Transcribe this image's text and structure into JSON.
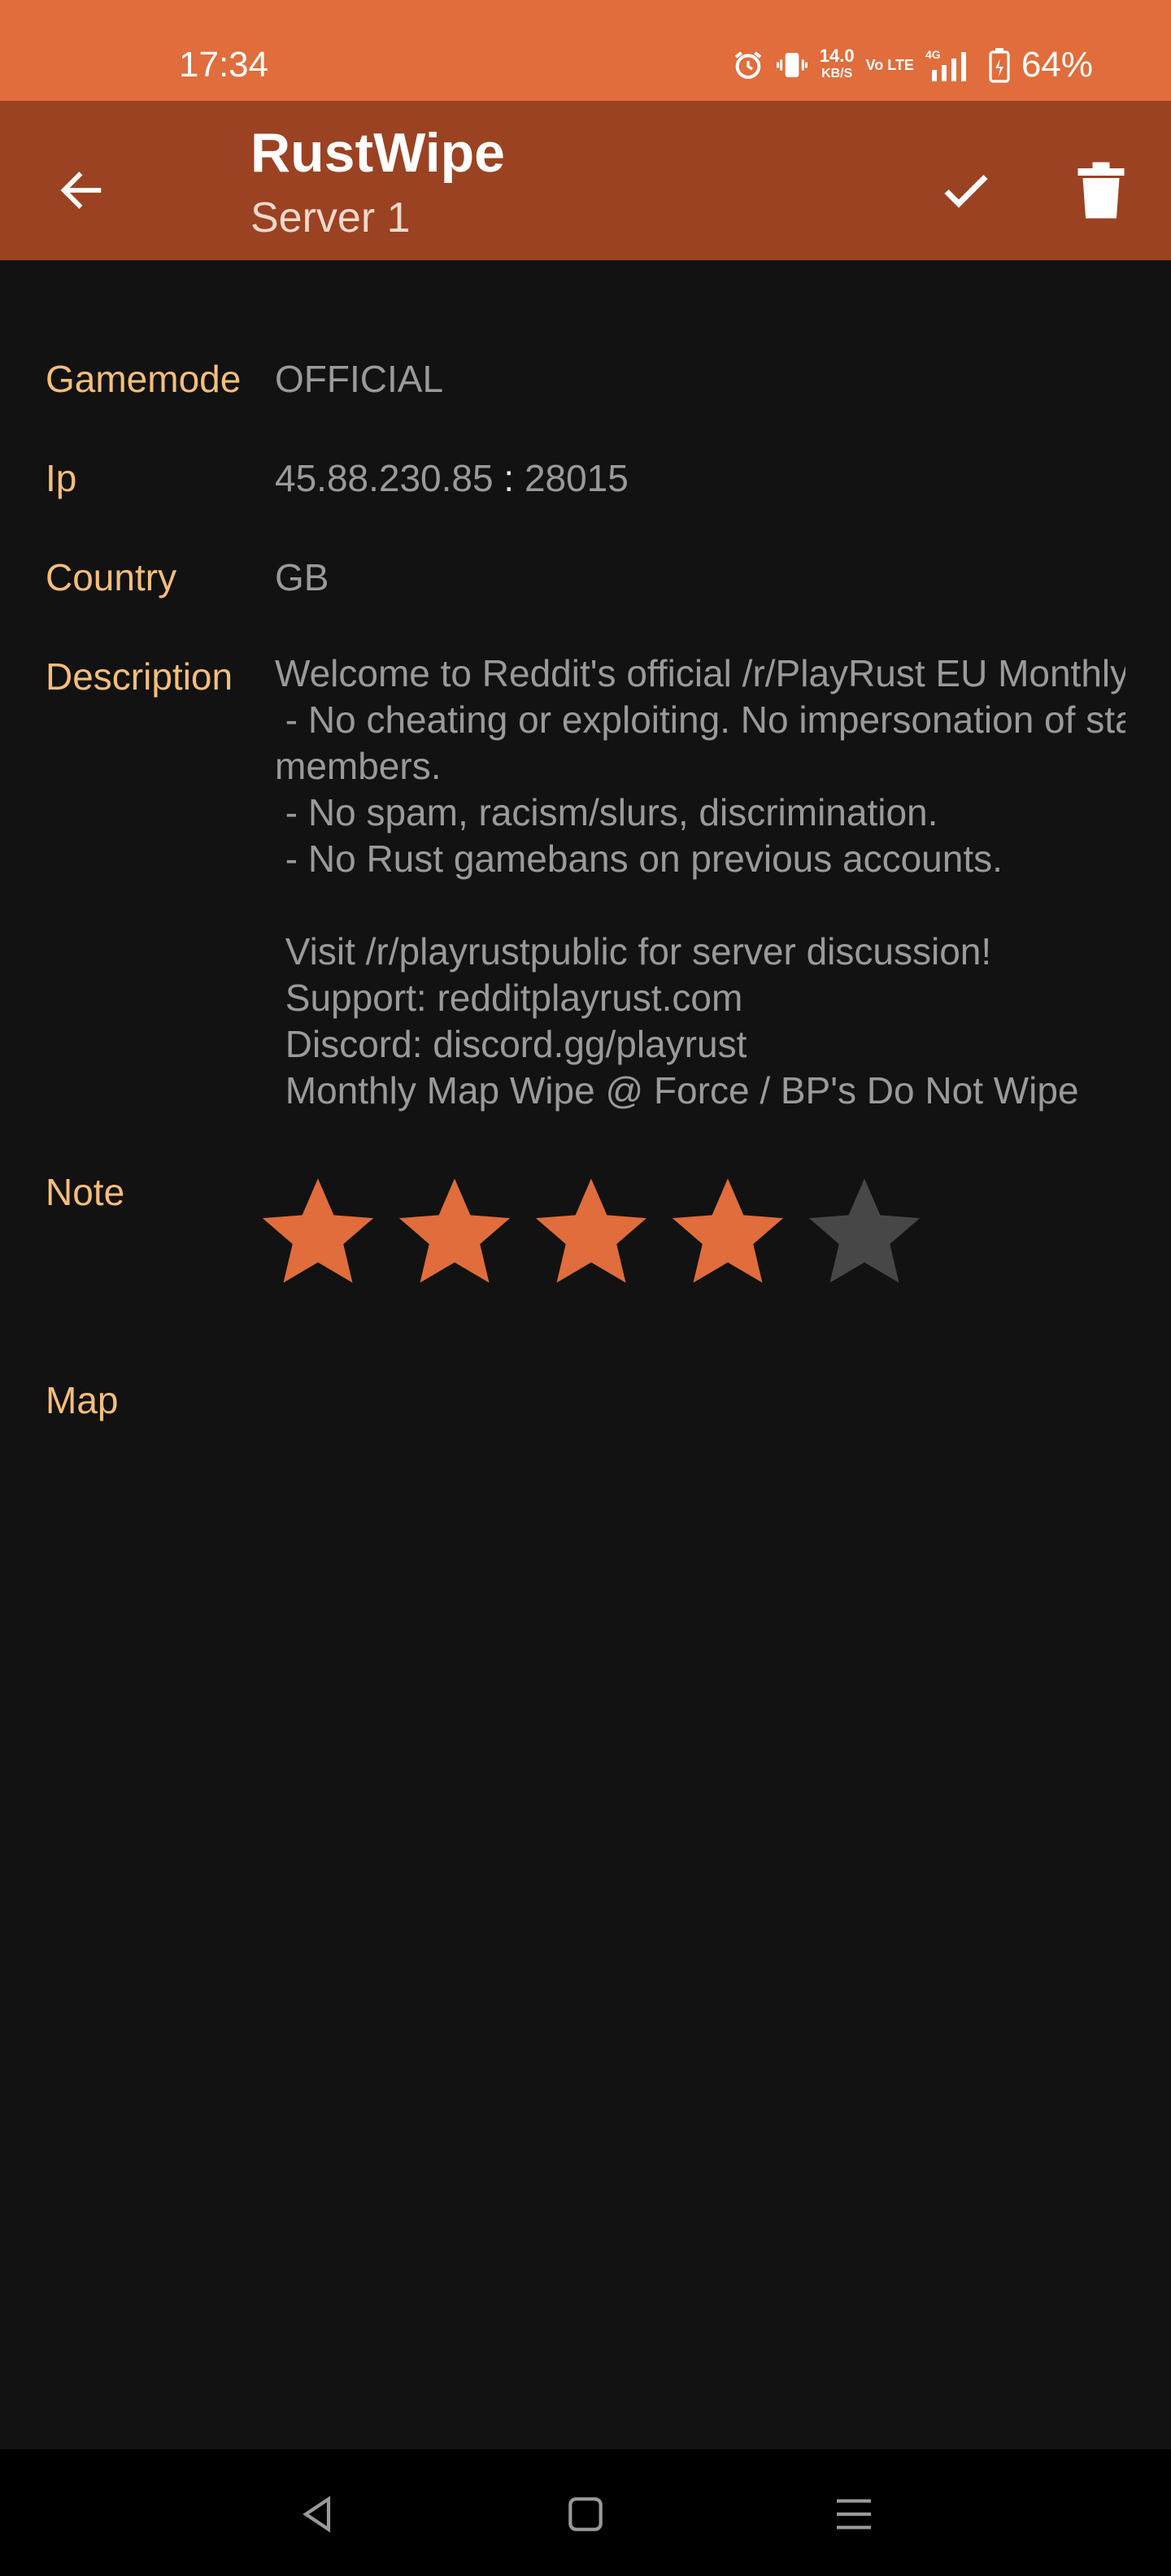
{
  "status_bar": {
    "time": "17:34",
    "net_speed": "14.0",
    "net_speed_unit": "KB/S",
    "volte": "Vo LTE",
    "network_type": "4G",
    "battery": "64%"
  },
  "toolbar": {
    "title": "RustWipe",
    "subtitle": "Server 1"
  },
  "fields": {
    "gamemode_label": "Gamemode",
    "gamemode_value": "OFFICIAL",
    "ip_label": "Ip",
    "ip_address": "45.88.230.85",
    "ip_sep": ":",
    "ip_port": "28015",
    "country_label": "Country",
    "country_value": "GB",
    "description_label": "Description",
    "description_lines": [
      "Welcome to Reddit's official /r/PlayRust EU Monthly",
      " - No cheating or exploiting. No impersonation of staff",
      "members.",
      " - No spam, racism/slurs, discrimination.",
      " - No Rust gamebans on previous accounts.",
      "",
      " Visit /r/playrustpublic for server discussion!",
      " Support: redditplayrust.com",
      " Discord: discord.gg/playrust",
      " Monthly Map Wipe @ Force / BP's Do Not Wipe"
    ],
    "note_label": "Note",
    "map_label": "Map"
  },
  "rating": {
    "value": 4,
    "max": 5
  },
  "colors": {
    "status_bar": "#E06D3B",
    "toolbar": "#9B4222",
    "label": "#F5BE79",
    "star_on": "#E06D3B",
    "star_off": "#474747"
  }
}
